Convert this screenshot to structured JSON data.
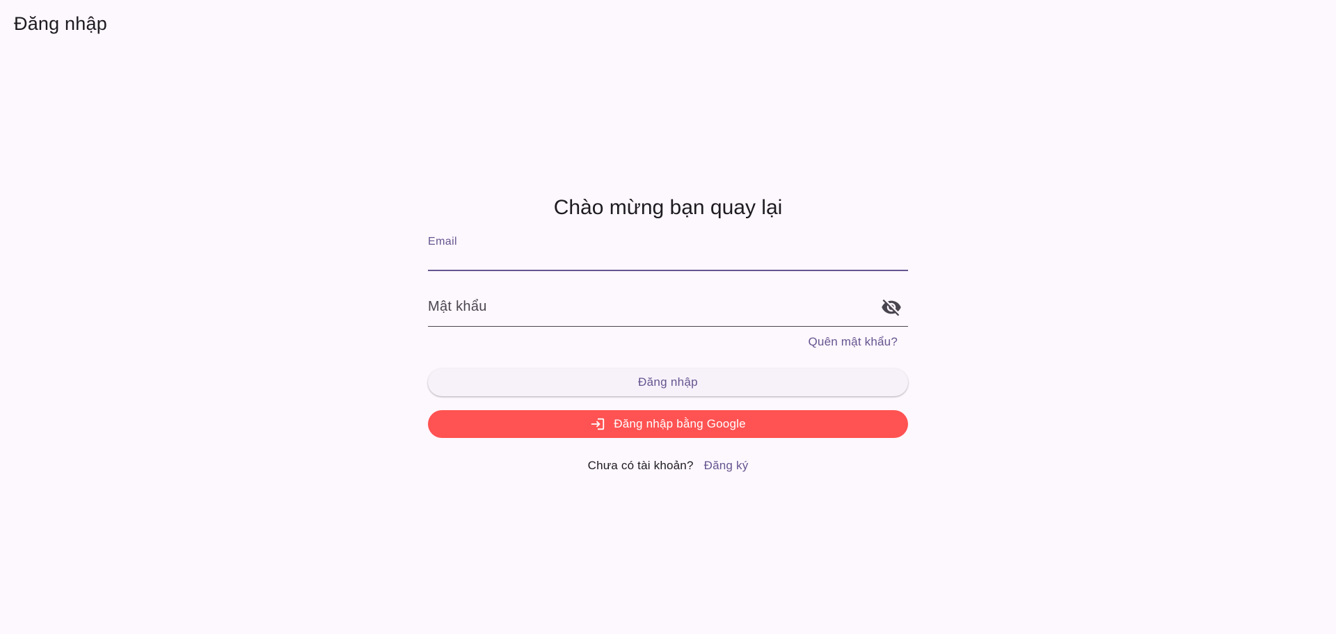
{
  "app_bar": {
    "title": "Đăng nhập"
  },
  "form": {
    "welcome_title": "Chào mừng bạn quay lại",
    "email": {
      "label": "Email",
      "value": ""
    },
    "password": {
      "placeholder": "Mật khẩu",
      "value": "",
      "visibility_icon": "visibility-off-icon"
    },
    "forgot_password_label": "Quên mật khẩu?",
    "login_button_label": "Đăng nhập",
    "google_button": {
      "label": "Đăng nhập bằng Google",
      "icon": "login-icon"
    },
    "signup": {
      "prompt": "Chưa có tài khoản?",
      "link_label": "Đăng ký"
    }
  },
  "colors": {
    "background": "#fdf7fe",
    "primary": "#65558f",
    "google_button": "#ff5252",
    "login_button_bg": "#f7f2fa"
  }
}
